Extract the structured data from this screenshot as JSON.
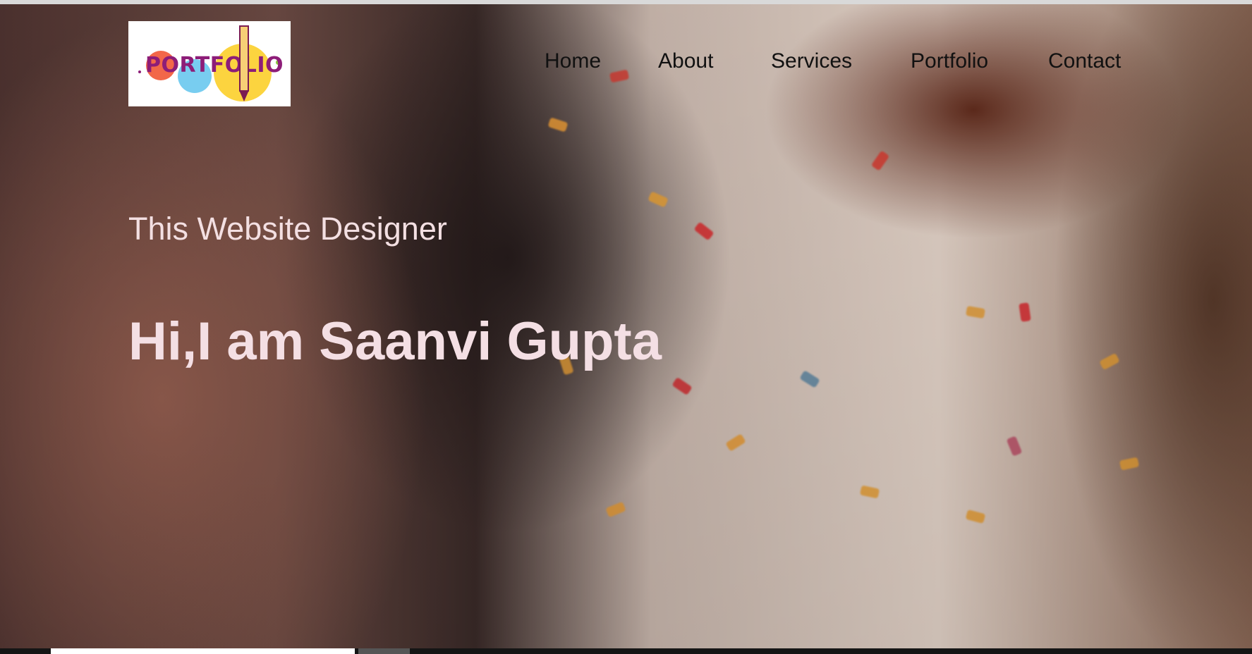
{
  "logo": {
    "text": "PORTFOLIO"
  },
  "nav": {
    "items": [
      {
        "label": "Home"
      },
      {
        "label": "About"
      },
      {
        "label": "Services"
      },
      {
        "label": "Portfolio"
      },
      {
        "label": "Contact"
      }
    ]
  },
  "hero": {
    "subtitle": "This Website Designer",
    "headline": "Hi,I am Saanvi Gupta"
  },
  "colors": {
    "nav_text": "#111111",
    "hero_text": "#f4dfe4",
    "logo_purple": "#8d1d78",
    "logo_yellow": "#f7cf76"
  },
  "icons": {
    "logo_icon": "pencil-icon"
  }
}
